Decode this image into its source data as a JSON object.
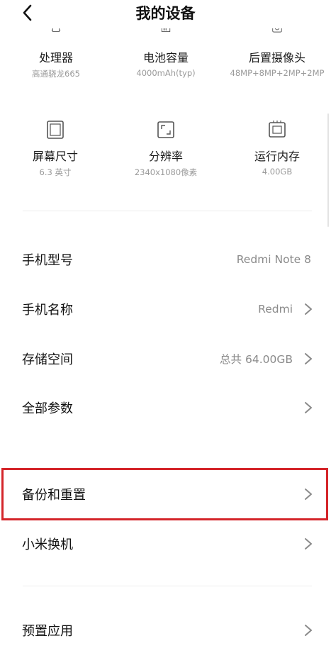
{
  "header": {
    "title": "我的设备"
  },
  "specs": [
    {
      "name": "处理器",
      "value": "高通骁龙665"
    },
    {
      "name": "电池容量",
      "value": "4000mAh(typ)"
    },
    {
      "name": "后置摄像头",
      "value": "48MP+8MP+2MP+2MP"
    },
    {
      "name": "屏幕尺寸",
      "value": "6.3 英寸"
    },
    {
      "name": "分辨率",
      "value": "2340x1080像素"
    },
    {
      "name": "运行内存",
      "value": "4.00GB"
    }
  ],
  "rows": [
    {
      "label": "手机型号",
      "value": "Redmi Note 8"
    },
    {
      "label": "手机名称",
      "value": "Redmi"
    },
    {
      "label": "存储空间",
      "value": "总共 64.00GB"
    },
    {
      "label": "全部参数",
      "value": ""
    },
    {
      "label": "备份和重置",
      "value": ""
    },
    {
      "label": "小米换机",
      "value": ""
    },
    {
      "label": "预置应用",
      "value": ""
    }
  ],
  "colors": {
    "highlight": "#d4252a",
    "secondary_text": "#9a9a9a"
  }
}
